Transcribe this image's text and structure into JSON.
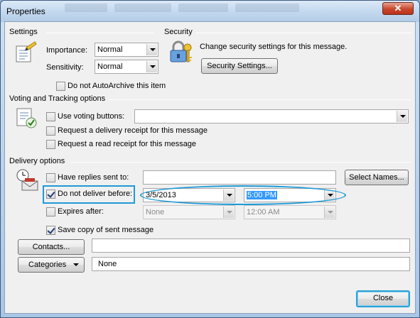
{
  "window": {
    "title": "Properties",
    "close_glyph": "✕"
  },
  "settings": {
    "heading": "Settings",
    "importance_label": "Importance:",
    "importance_value": "Normal",
    "sensitivity_label": "Sensitivity:",
    "sensitivity_value": "Normal",
    "autoarchive_label": "Do not AutoArchive this item",
    "autoarchive_checked": false
  },
  "security": {
    "heading": "Security",
    "description": "Change security settings for this message.",
    "button_label": "Security Settings..."
  },
  "voting": {
    "heading": "Voting and Tracking options",
    "use_voting_label": "Use voting buttons:",
    "use_voting_value": "",
    "delivery_receipt_label": "Request a delivery receipt for this message",
    "read_receipt_label": "Request a read receipt for this message"
  },
  "delivery": {
    "heading": "Delivery options",
    "replies_label": "Have replies sent to:",
    "replies_value": "",
    "select_names_label": "Select Names...",
    "do_not_deliver_label": "Do not deliver before:",
    "do_not_deliver_checked": true,
    "deliver_date": "3/5/2013",
    "deliver_time": "5:00 PM",
    "expires_label": "Expires after:",
    "expires_checked": false,
    "expires_date": "None",
    "expires_time": "12:00 AM",
    "save_copy_label": "Save copy of sent message",
    "save_copy_checked": true
  },
  "contacts": {
    "button_label": "Contacts...",
    "value": ""
  },
  "categories": {
    "button_label": "Categories",
    "value": "None"
  },
  "footer": {
    "close_label": "Close"
  },
  "colors": {
    "highlight": "#1e9ad6",
    "title_bar": "#c4d9ef",
    "close_button": "#c8472c"
  },
  "icons": [
    "settings-icon",
    "security-icon",
    "voting-icon",
    "delivery-icon"
  ]
}
